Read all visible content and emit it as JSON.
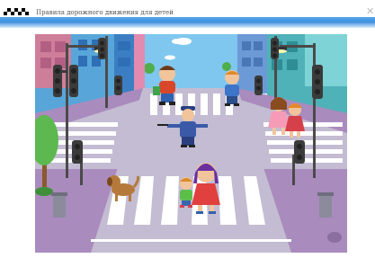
{
  "window": {
    "title": "Правила дорожного движения для детей",
    "close_glyph": "✕",
    "accent_color": "#4a9be8"
  },
  "scene": {
    "sky_color": "#7fc7ef",
    "road_color": "#bfb7cf",
    "sidewalk_color": "#a98bbd",
    "crosswalk_color": "#ffffff"
  }
}
